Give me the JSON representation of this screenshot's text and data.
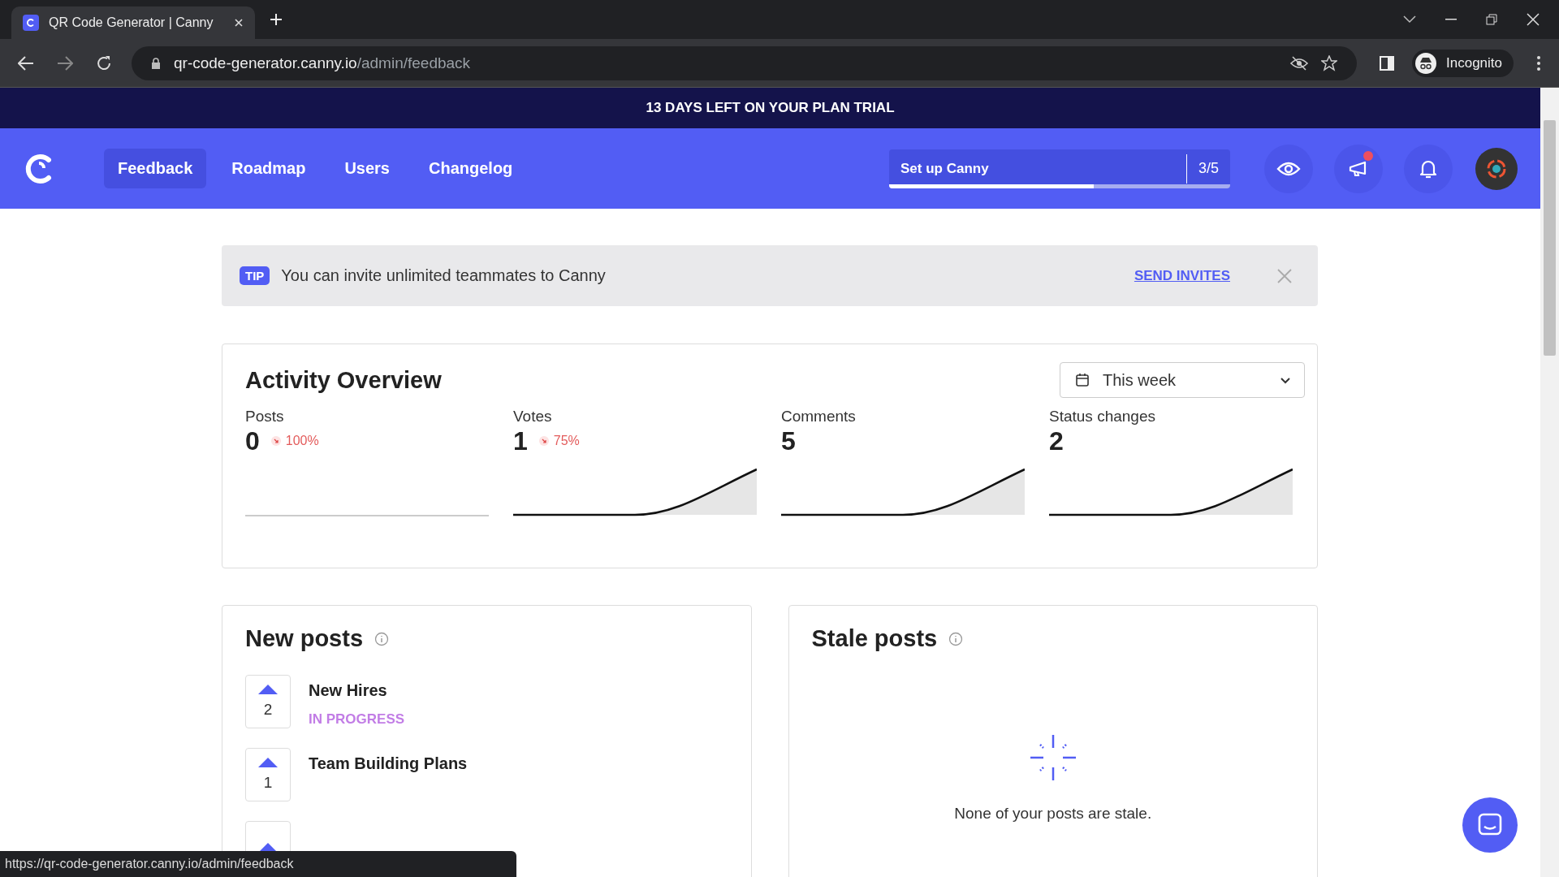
{
  "browser": {
    "tab_title": "QR Code Generator | Canny",
    "url_host": "qr-code-generator.canny.io",
    "url_path": "/admin/feedback",
    "profile": "Incognito",
    "status_url": "https://qr-code-generator.canny.io/admin/feedback"
  },
  "trial_banner": "13 DAYS LEFT ON YOUR PLAN TRIAL",
  "nav": {
    "items": [
      {
        "label": "Feedback",
        "selected": true
      },
      {
        "label": "Roadmap",
        "selected": false
      },
      {
        "label": "Users",
        "selected": false
      },
      {
        "label": "Changelog",
        "selected": false
      }
    ],
    "setup": {
      "label": "Set up Canny",
      "count": "3/5",
      "level": 0.6
    },
    "announcements_unread": true
  },
  "tip": {
    "badge": "TIP",
    "text": "You can invite unlimited teammates to Canny",
    "action": "SEND INVITES"
  },
  "activity": {
    "title": "Activity Overview",
    "range": "This week",
    "metrics": [
      {
        "label": "Posts",
        "value": "0",
        "change": "100%",
        "rising": false
      },
      {
        "label": "Votes",
        "value": "1",
        "change": "75%",
        "rising": true
      },
      {
        "label": "Comments",
        "value": "5",
        "rising": true
      },
      {
        "label": "Status changes",
        "value": "2",
        "rising": true
      }
    ]
  },
  "new_posts": {
    "title": "New posts",
    "posts": [
      {
        "votes": "2",
        "title": "New Hires",
        "status": "IN PROGRESS",
        "color": "#c27de6"
      },
      {
        "votes": "1",
        "title": "Team Building Plans"
      },
      {
        "kind": "partial"
      }
    ]
  },
  "stale_posts": {
    "title": "Stale posts",
    "empty": "None of your posts are stale."
  }
}
